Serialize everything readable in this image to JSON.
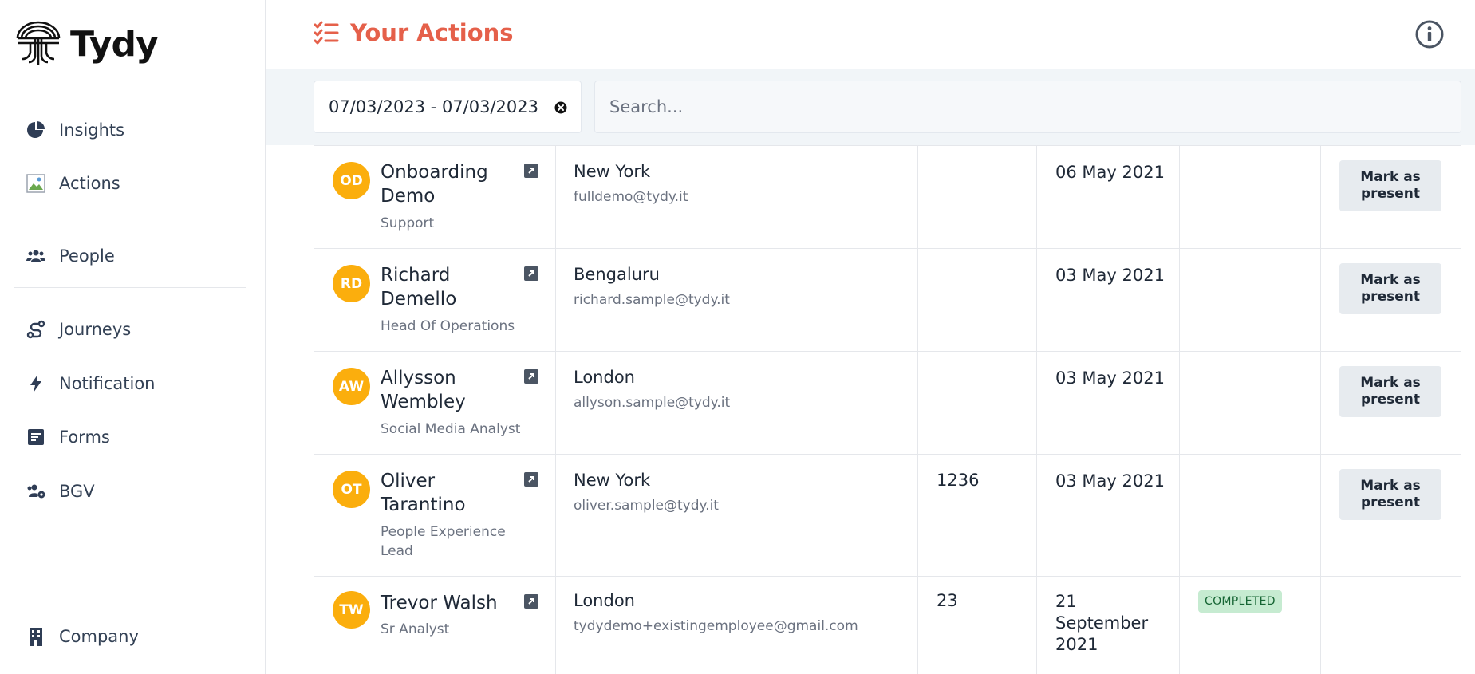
{
  "brand": {
    "name": "Tydy"
  },
  "sidebar": {
    "items": [
      {
        "label": "Insights",
        "icon": "pie-chart-icon"
      },
      {
        "label": "Actions",
        "icon": "broken-image-icon"
      },
      {
        "label": "People",
        "icon": "users-icon"
      },
      {
        "label": "Journeys",
        "icon": "route-icon"
      },
      {
        "label": "Notification",
        "icon": "bolt-icon"
      },
      {
        "label": "Forms",
        "icon": "form-icon"
      },
      {
        "label": "BGV",
        "icon": "users-cog-icon"
      },
      {
        "label": "Company",
        "icon": "building-icon"
      }
    ]
  },
  "header": {
    "title": "Your Actions",
    "accent_color": "#e5604a"
  },
  "filters": {
    "date_range": "07/03/2023 - 07/03/2023",
    "search_placeholder": "Search..."
  },
  "rows": [
    {
      "initials": "OD",
      "name": "Onboarding Demo",
      "role": "Support",
      "city": "New York",
      "email": "fulldemo@tydy.it",
      "number": "",
      "date": "06 May 2021",
      "status": "",
      "action": "Mark as present"
    },
    {
      "initials": "RD",
      "name": "Richard Demello",
      "role": "Head Of Operations",
      "city": "Bengaluru",
      "email": "richard.sample@tydy.it",
      "number": "",
      "date": "03 May 2021",
      "status": "",
      "action": "Mark as present"
    },
    {
      "initials": "AW",
      "name": "Allysson Wembley",
      "role": "Social Media Analyst",
      "city": "London",
      "email": "allyson.sample@tydy.it",
      "number": "",
      "date": "03 May 2021",
      "status": "",
      "action": "Mark as present"
    },
    {
      "initials": "OT",
      "name": "Oliver Tarantino",
      "role": "People Experience Lead",
      "city": "New York",
      "email": "oliver.sample@tydy.it",
      "number": "1236",
      "date": "03 May 2021",
      "status": "",
      "action": "Mark as present"
    },
    {
      "initials": "TW",
      "name": "Trevor Walsh",
      "role": "Sr Analyst",
      "city": "London",
      "email": "tydydemo+existingemployee@gmail.com",
      "number": "23",
      "date": "21 September 2021",
      "status": "COMPLETED",
      "action": ""
    }
  ]
}
